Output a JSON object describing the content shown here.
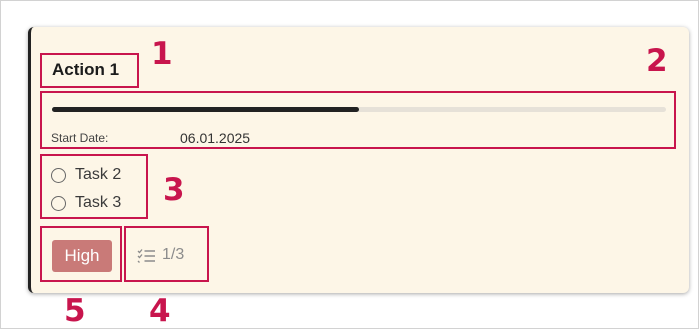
{
  "card": {
    "title": "Action 1",
    "progress_fraction": 0.5,
    "start_date_label": "Start Date:",
    "start_date_value": "06.01.2025",
    "tasks": [
      {
        "label": "Task 2",
        "checked": false
      },
      {
        "label": "Task 3",
        "checked": false
      }
    ],
    "priority_badge": "High",
    "checklist_count": "1/3",
    "checklist_icon": "checklist-icon"
  },
  "callouts": [
    "1",
    "2",
    "3",
    "4",
    "5"
  ],
  "colors": {
    "card_background": "#fdf6e7",
    "accent_border": "#222222",
    "callout": "#c8154d",
    "badge_high": "#c97a78",
    "progress_fill": "#222222",
    "progress_track": "#e6e1d8"
  }
}
